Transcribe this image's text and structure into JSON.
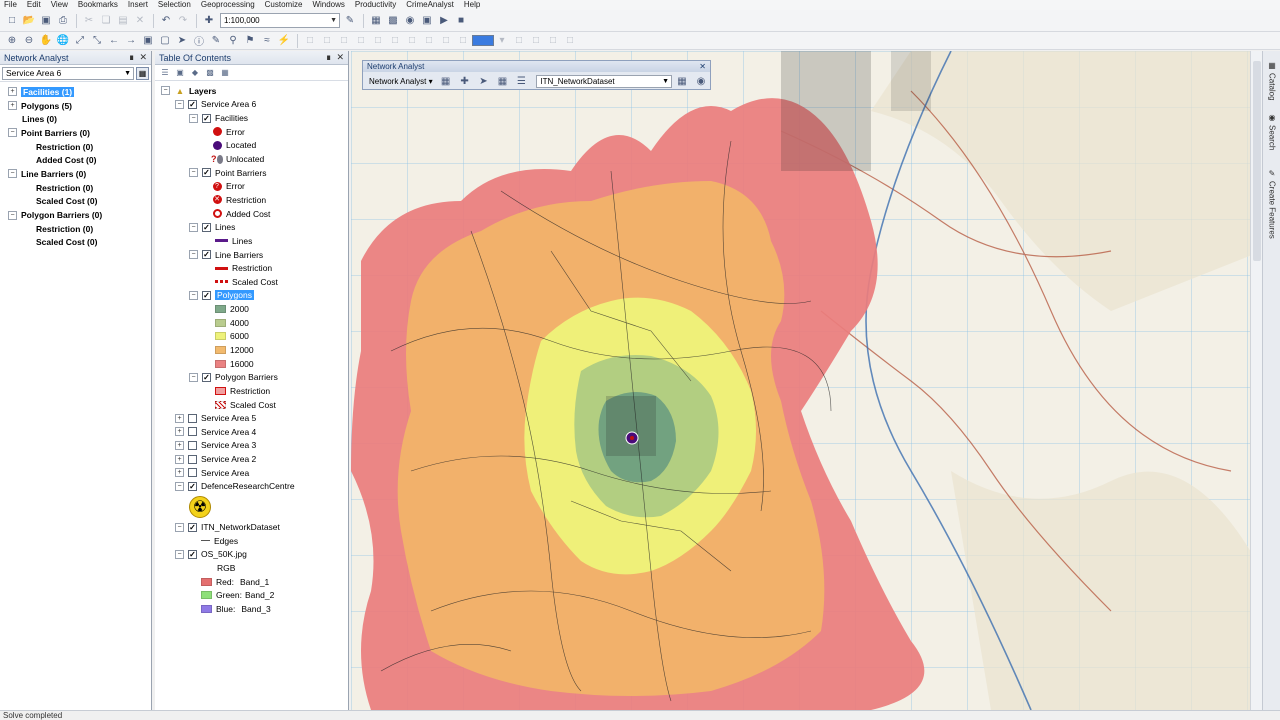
{
  "menu": [
    "File",
    "Edit",
    "View",
    "Bookmarks",
    "Insert",
    "Selection",
    "Geoprocessing",
    "Customize",
    "Windows",
    "Productivity",
    "CrimeAnalyst",
    "Help"
  ],
  "toolbar": {
    "scale": "1:100,000"
  },
  "network_analyst_pane": {
    "title": "Network Analyst",
    "analysis_layer": "Service Area 6",
    "tree": [
      {
        "label": "Facilities (1)",
        "selected": true
      },
      {
        "label": "Polygons (5)"
      },
      {
        "label": "Lines (0)"
      },
      {
        "label": "Point Barriers (0)"
      },
      {
        "label": "Restriction (0)"
      },
      {
        "label": "Added Cost (0)"
      },
      {
        "label": "Line Barriers (0)"
      },
      {
        "label": "Restriction (0)"
      },
      {
        "label": "Scaled Cost (0)"
      },
      {
        "label": "Polygon Barriers (0)"
      },
      {
        "label": "Restriction (0)"
      },
      {
        "label": "Scaled Cost (0)"
      }
    ]
  },
  "toc": {
    "title": "Table Of Contents",
    "layers_label": "Layers",
    "service_area_6": "Service Area 6",
    "facilities": "Facilities",
    "fac_error": "Error",
    "fac_located": "Located",
    "fac_unlocated": "Unlocated",
    "point_barriers": "Point Barriers",
    "pb_error": "Error",
    "pb_restriction": "Restriction",
    "pb_added_cost": "Added Cost",
    "lines": "Lines",
    "lines_sym": "Lines",
    "line_barriers": "Line Barriers",
    "lb_restriction": "Restriction",
    "lb_scaled_cost": "Scaled Cost",
    "polygons": "Polygons",
    "breaks": [
      {
        "label": "2000",
        "color": "#7fa98a"
      },
      {
        "label": "4000",
        "color": "#b9cc8e"
      },
      {
        "label": "6000",
        "color": "#eef27a"
      },
      {
        "label": "12000",
        "color": "#f2ba6e"
      },
      {
        "label": "16000",
        "color": "#ea8282"
      }
    ],
    "polygon_barriers": "Polygon Barriers",
    "pgb_restriction": "Restriction",
    "pgb_scaled_cost": "Scaled Cost",
    "sa5": "Service Area 5",
    "sa4": "Service Area 4",
    "sa3": "Service Area 3",
    "sa2": "Service Area 2",
    "sa": "Service Area",
    "defence": "DefenceResearchCentre",
    "itn": "ITN_NetworkDataset",
    "edges": "Edges",
    "os": "OS_50K.jpg",
    "rgb": "RGB",
    "red_label": "Red:",
    "red_band": "Band_1",
    "green_label": "Green:",
    "green_band": "Band_2",
    "blue_label": "Blue:",
    "blue_band": "Band_3"
  },
  "na_toolbar": {
    "title": "Network Analyst",
    "dropdown": "Network Analyst",
    "dataset": "ITN_NetworkDataset"
  },
  "right_tabs": [
    "Catalog",
    "Search",
    "Create Features"
  ],
  "status": "Solve completed"
}
